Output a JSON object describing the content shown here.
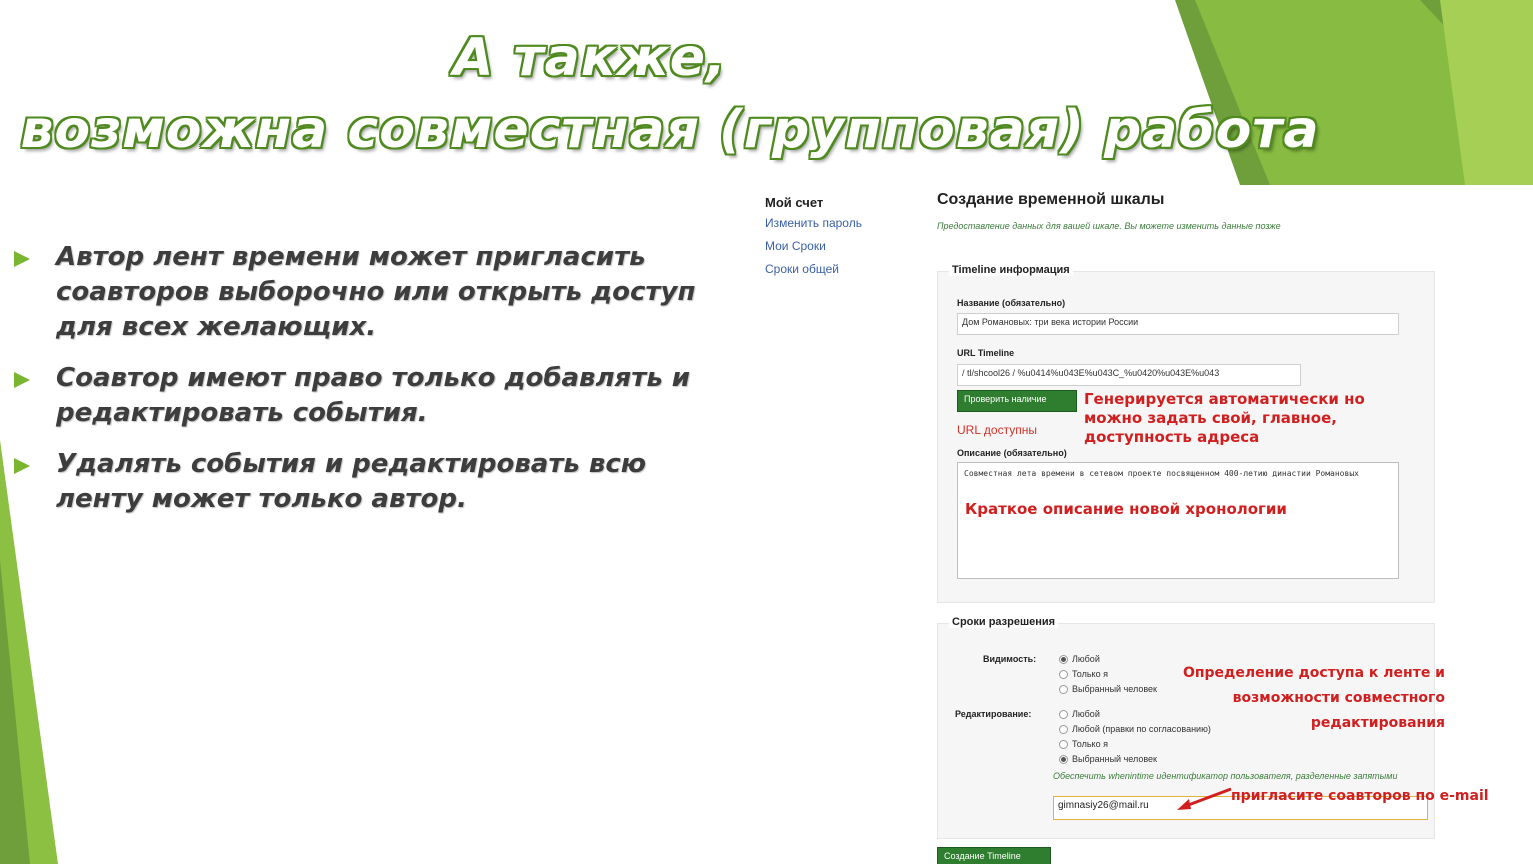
{
  "slide": {
    "title_line1": "А также,",
    "title_line2": "возможна совместная (групповая) работа",
    "bullets": [
      "Автор лент времени может пригласить соавторов выборочно или открыть доступ для всех желающих.",
      "Соавтор имеют право только добавлять и редактировать события.",
      "Удалять события и редактировать всю ленту может только автор."
    ],
    "accent_color": "#7ab52f"
  },
  "screenshot": {
    "sidebar": {
      "account": "Мой счет",
      "links": [
        "Изменить пароль",
        "Мои Сроки",
        "Сроки общей"
      ]
    },
    "heading": "Создание временной шкалы",
    "subheading": "Предоставление данных для вашей шкале. Вы можете изменить данные позже",
    "info_section": {
      "legend": "Timeline информация",
      "name_label": "Название (обязательно)",
      "name_value": "Дом Романовых: три века истории России",
      "url_label": "URL Timeline",
      "url_value": "/ tl/shcool26 / %u0414%u043E%u043C_%u0420%u043E%u043",
      "check_button": "Проверить наличие",
      "url_status": "URL доступны",
      "description_label": "Описание (обязательно)",
      "description_value": "Совместная лета времени в сетевом проекте посвященном 400-летию династии Романовых"
    },
    "permissions_section": {
      "legend": "Сроки разрешения",
      "visibility_label": "Видимость:",
      "visibility_options": [
        "Любой",
        "Только я",
        "Выбранный человек"
      ],
      "visibility_selected": 0,
      "editing_label": "Редактирование:",
      "editing_options": [
        "Любой",
        "Любой (правки по согласованию)",
        "Только я",
        "Выбранный человек"
      ],
      "editing_selected": 3,
      "hint": "Обеспечить whenintime идентификатор пользователя, разделенные запятыми",
      "email_value": "gimnasiy26@mail.ru"
    },
    "submit_button": "Создание Timeline",
    "annotations": {
      "auto": "Генерируется автоматически но можно задать свой, главное, доступность адреса",
      "desc": "Краткое описание новой хронологии",
      "access": "Определение доступа к ленте и возможности совместного редактирования",
      "invite": "пригласите соавторов по e-mail"
    },
    "annotation_color": "#d11f1f"
  }
}
